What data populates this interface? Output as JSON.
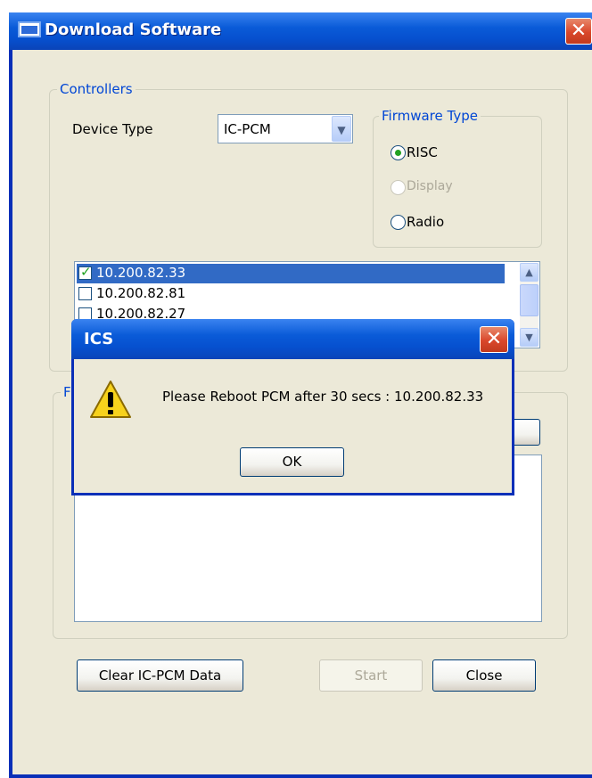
{
  "window": {
    "title": "Download Software",
    "close_glyph": "✕"
  },
  "controllers": {
    "legend": "Controllers",
    "device_type_label": "Device Type",
    "device_type_value": "IC-PCM",
    "firmware_type": {
      "legend": "Firmware Type",
      "options": [
        {
          "label": "RISC",
          "checked": true,
          "enabled": true
        },
        {
          "label": "Display",
          "checked": false,
          "enabled": false
        },
        {
          "label": "Radio",
          "checked": false,
          "enabled": true
        }
      ]
    },
    "devices": [
      {
        "ip": "10.200.82.33",
        "checked": true,
        "selected": true
      },
      {
        "ip": "10.200.82.81",
        "checked": false,
        "selected": false
      },
      {
        "ip": "10.200.82.27",
        "checked": false,
        "selected": false
      }
    ]
  },
  "file_group": {
    "legend": "F"
  },
  "buttons": {
    "clear": "Clear IC-PCM Data",
    "start": "Start",
    "close": "Close"
  },
  "modal": {
    "title": "ICS",
    "message": "Please Reboot PCM after 30 secs : 10.200.82.33",
    "ok": "OK",
    "icon": "warning-icon"
  },
  "colors": {
    "accent": "#0046d5",
    "selection": "#316ac5",
    "check": "#21a121"
  }
}
